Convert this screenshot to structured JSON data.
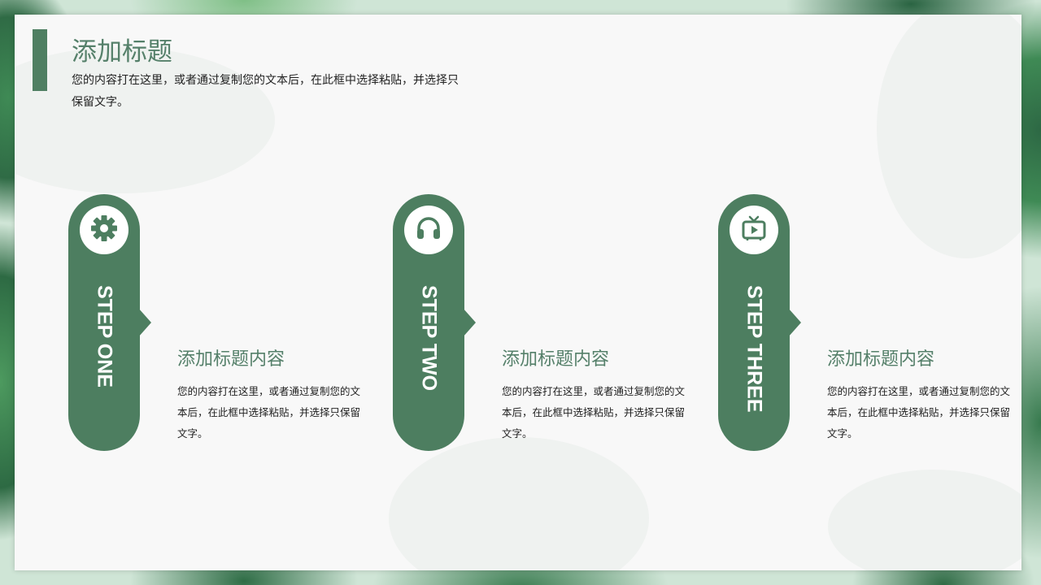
{
  "slide": {
    "title": "添加标题",
    "description": "您的内容打在这里，或者通过复制您的文本后，在此框中选择粘贴，并选择只保留文字。"
  },
  "steps": [
    {
      "label": "STEP ONE",
      "icon": "gear-icon",
      "heading": "添加标题内容",
      "description": "您的内容打在这里，或者通过复制您的文本后，在此框中选择粘贴，并选择只保留文字。"
    },
    {
      "label": "STEP TWO",
      "icon": "headphones-icon",
      "heading": "添加标题内容",
      "description": "您的内容打在这里，或者通过复制您的文本后，在此框中选择粘贴，并选择只保留文字。"
    },
    {
      "label": "STEP THREE",
      "icon": "tv-icon",
      "heading": "添加标题内容",
      "description": "您的内容打在这里，或者通过复制您的文本后，在此框中选择粘贴，并选择只保留文字。"
    }
  ],
  "colors": {
    "accent": "#4d7e60",
    "title": "#55806a",
    "card": "#f8f8f8",
    "text": "#222222"
  }
}
